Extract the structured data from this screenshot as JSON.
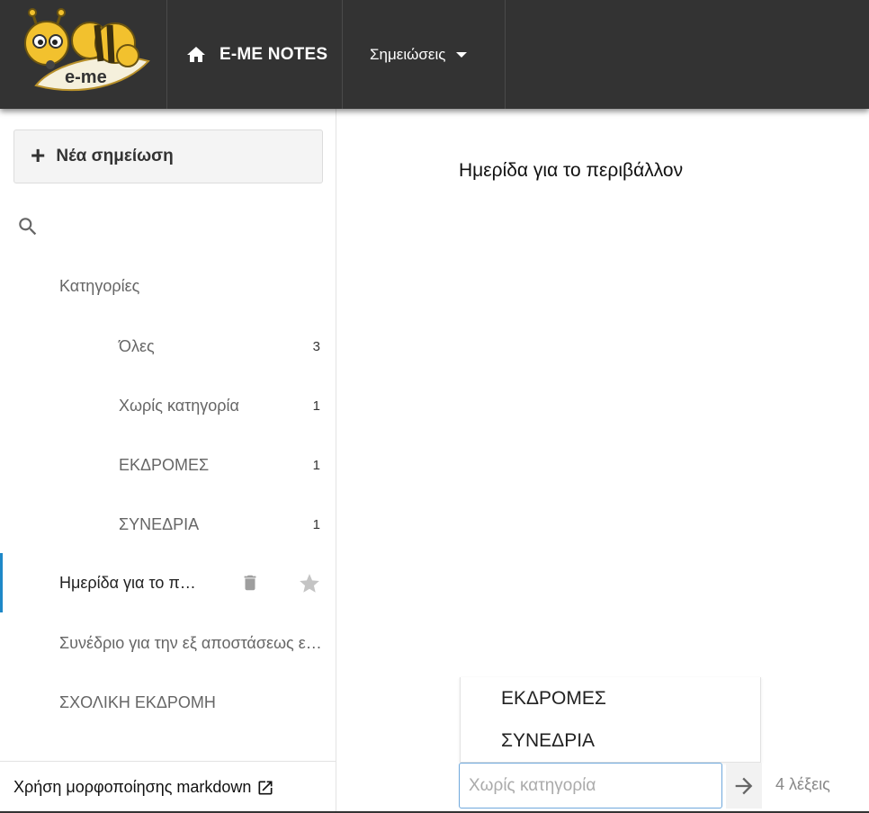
{
  "header": {
    "logo_text": "e-me",
    "brand": "E-ME NOTES",
    "menu_label": "Σημειώσεις"
  },
  "sidebar": {
    "new_note_label": "Νέα σημείωση",
    "categories_heading": "Κατηγορίες",
    "categories": [
      {
        "label": "Όλες",
        "count": "3"
      },
      {
        "label": "Χωρίς κατηγορία",
        "count": "1"
      },
      {
        "label": "ΕΚΔΡΟΜΕΣ",
        "count": "1"
      },
      {
        "label": "ΣΥΝΕΔΡΙΑ",
        "count": "1"
      }
    ],
    "notes": [
      {
        "title": "Ημερίδα για το περιβάλλον",
        "active": true
      },
      {
        "title": "Συνέδριο για την εξ αποστάσεως εκπαίδευση",
        "active": false
      },
      {
        "title": "ΣΧΟΛΙΚΗ ΕΚΔΡΟΜΗ",
        "active": false
      }
    ],
    "footer_link": "Χρήση μορφοποίησης markdown"
  },
  "main": {
    "note_title": "Ημερίδα για το περιβάλλον",
    "category_options": [
      "ΕΚΔΡΟΜΕΣ",
      "ΣΥΝΕΔΡΙΑ"
    ],
    "category_input_placeholder": "Χωρίς κατηγορία",
    "category_input_value": "",
    "word_count": "4 λέξεις"
  },
  "colors": {
    "header_bg": "#333333",
    "active_indicator": "#1e88c8",
    "logo_yellow": "#f2c12e"
  }
}
